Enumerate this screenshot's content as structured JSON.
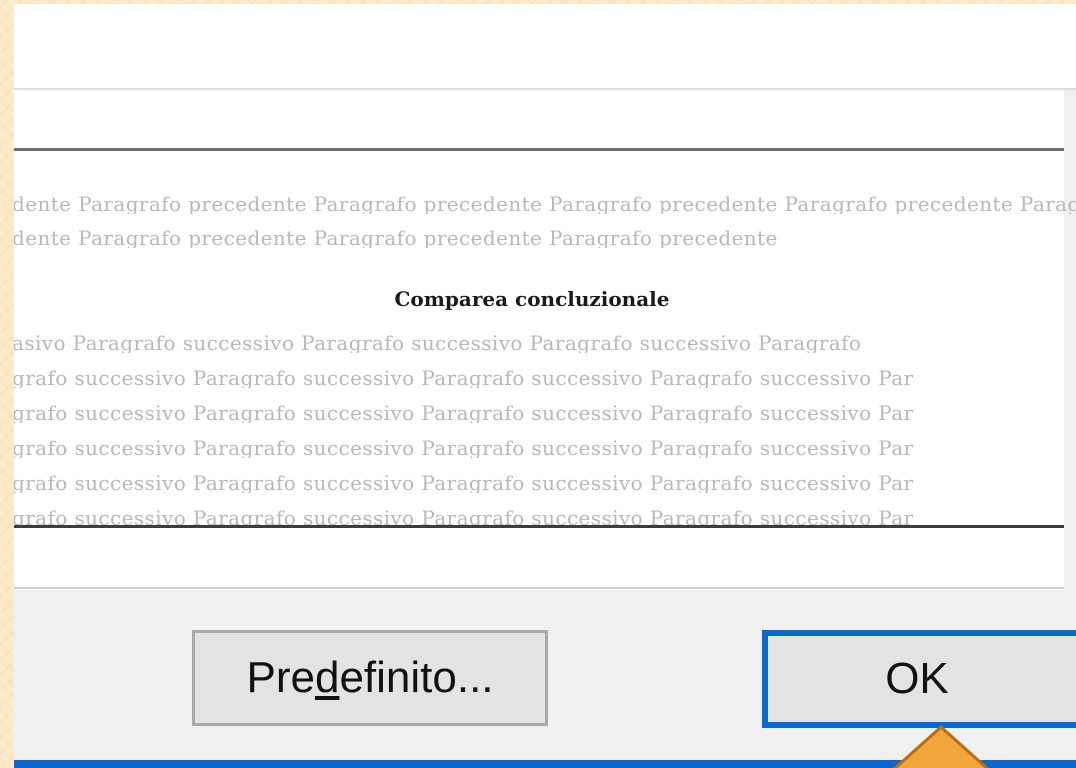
{
  "preview": {
    "previous_line_1": "dente Paragrafo precedente Paragrafo precedente Paragrafo precedente Paragrafo precedente Paragrafo pre",
    "previous_line_2": "dente Paragrafo precedente Paragrafo precedente Paragrafo precedente",
    "current_paragraph": "Comparea concluzionale",
    "next_lines": [
      "asivo Paragrafo successivo Paragrafo successivo Paragrafo successivo Paragrafo",
      "grafo successivo Paragrafo successivo Paragrafo successivo Paragrafo successivo Par",
      "grafo successivo Paragrafo successivo Paragrafo successivo Paragrafo successivo Par",
      "grafo successivo Paragrafo successivo Paragrafo successivo Paragrafo successivo Par",
      "grafo successivo Paragrafo successivo Paragrafo successivo Paragrafo successivo Par",
      "grafo successivo Paragrafo successivo Paragrafo successivo Paragrafo successivo Par"
    ]
  },
  "buttons": {
    "default_label_pre": "Pre",
    "default_label_mnemonic": "d",
    "default_label_post": "efinito...",
    "ok_label": "OK"
  },
  "colors": {
    "accent": "#0a68d0",
    "pointer": "#f2a53a"
  },
  "icons": {
    "pointer": "triangle-pointer-icon"
  }
}
